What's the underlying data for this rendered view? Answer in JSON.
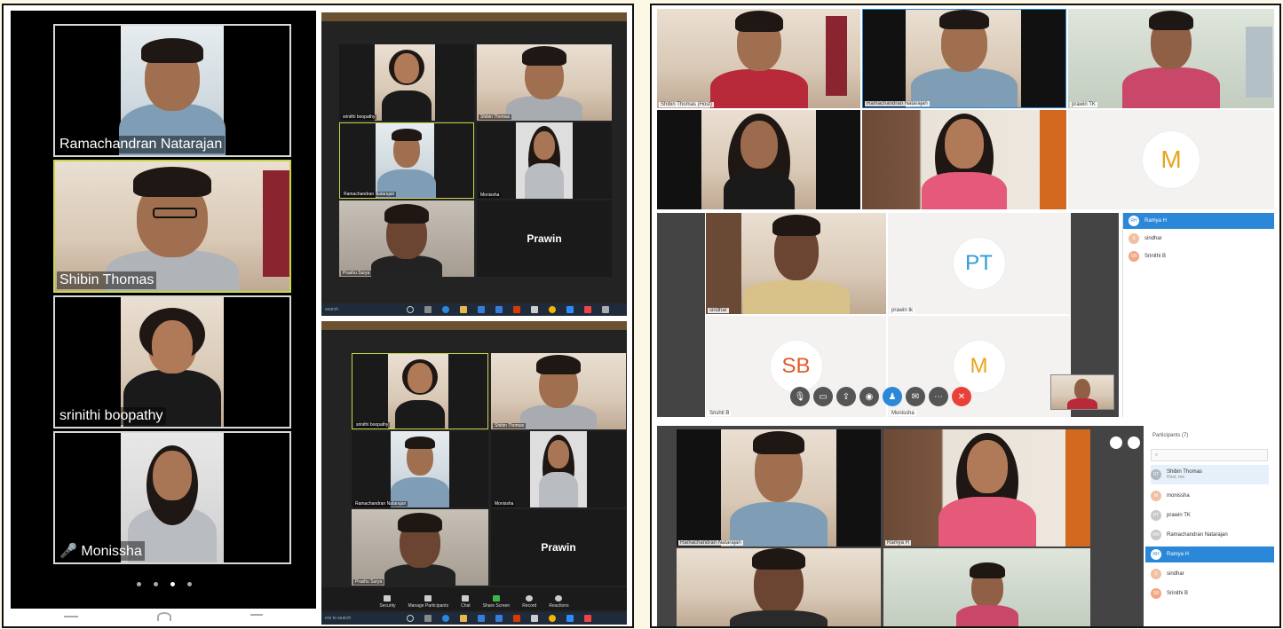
{
  "colors": {
    "background": "#fdf7e6",
    "zoom_dark": "#232323",
    "active_speaker": "#c8d64a",
    "teams_blue": "#2b88d8",
    "initials_orange": "#e8a51c",
    "initials_blue": "#2f9bd6",
    "initials_red": "#e05a2b",
    "end_call_red": "#e8413a"
  },
  "phone": {
    "participants": [
      {
        "name": "Ramachandran Natarajan"
      },
      {
        "name": "Shibin Thomas"
      },
      {
        "name": "srinithi boopathy"
      },
      {
        "name": "Monissha",
        "mic_icon": "mic-muted-icon"
      }
    ],
    "page_dots": 4,
    "active_dot": 3
  },
  "zoom_top": {
    "tiles": [
      {
        "name": "srinithi boopathy"
      },
      {
        "name": "Shibin Thomas"
      },
      {
        "name": "Ramachandran Natarajan"
      },
      {
        "name": "Monissha"
      },
      {
        "name": "Prashu Surya"
      },
      {
        "name": "Prawin"
      }
    ],
    "search_placeholder": "search"
  },
  "zoom_bottom": {
    "tiles": [
      {
        "name": "srinithi boopathy"
      },
      {
        "name": "Shibin Thomas"
      },
      {
        "name": "Ramachandran Natarajan"
      },
      {
        "name": "Monissha"
      },
      {
        "name": "Prashu Surya"
      },
      {
        "name": "Prawin"
      }
    ],
    "toolbar": [
      {
        "label": "Security",
        "icon": "shield-icon"
      },
      {
        "label": "Manage Participants",
        "icon": "participants-icon"
      },
      {
        "label": "Chat",
        "icon": "chat-icon"
      },
      {
        "label": "Share Screen",
        "icon": "share-screen-icon"
      },
      {
        "label": "Record",
        "icon": "record-icon"
      },
      {
        "label": "Reactions",
        "icon": "reactions-icon"
      }
    ],
    "search_placeholder": "ere to search"
  },
  "teams_top": {
    "row1": [
      {
        "name": "Shibin Thomas",
        "tag": "(Host)"
      },
      {
        "name": "Ramachandran Natarajan"
      },
      {
        "name": "prawin TK"
      }
    ],
    "row2": [
      {
        "name": ""
      },
      {
        "name": ""
      },
      {
        "initials": "M"
      }
    ]
  },
  "teams_mid": {
    "tiles": [
      {
        "name": "sindhar"
      },
      {
        "name": "prawin tk",
        "initials": "PT"
      },
      {
        "name": "Srishti B",
        "initials": "SB"
      },
      {
        "name": "Monissha",
        "initials": "M"
      }
    ],
    "participants": [
      {
        "name": "Ramya H",
        "initials": "RH"
      },
      {
        "name": "sindhar",
        "initials": "S"
      },
      {
        "name": "Srinithi B",
        "initials": "SB"
      }
    ],
    "controls": [
      "mic-icon",
      "video-icon",
      "share-icon",
      "record-icon",
      "participants-icon",
      "chat-icon",
      "more-icon",
      "end-call-icon"
    ]
  },
  "teams_bottom": {
    "tiles": [
      {
        "name": "Ramachandran Natarajan"
      },
      {
        "name": "Ramya H"
      },
      {
        "name": ""
      },
      {
        "name": ""
      }
    ],
    "panel_title": "Participants (7)",
    "search_placeholder": "",
    "participants": [
      {
        "name": "Shibin Thomas",
        "sub": "Host, me",
        "initials": "ST"
      },
      {
        "name": "monissha",
        "initials": "M"
      },
      {
        "name": "prawin TK",
        "initials": "PT"
      },
      {
        "name": "Ramachandran Natarajan",
        "initials": "RN"
      },
      {
        "name": "Ramya H",
        "initials": "RH"
      },
      {
        "name": "sindhar",
        "initials": "S"
      },
      {
        "name": "Srinithi B",
        "initials": "SB"
      }
    ]
  }
}
